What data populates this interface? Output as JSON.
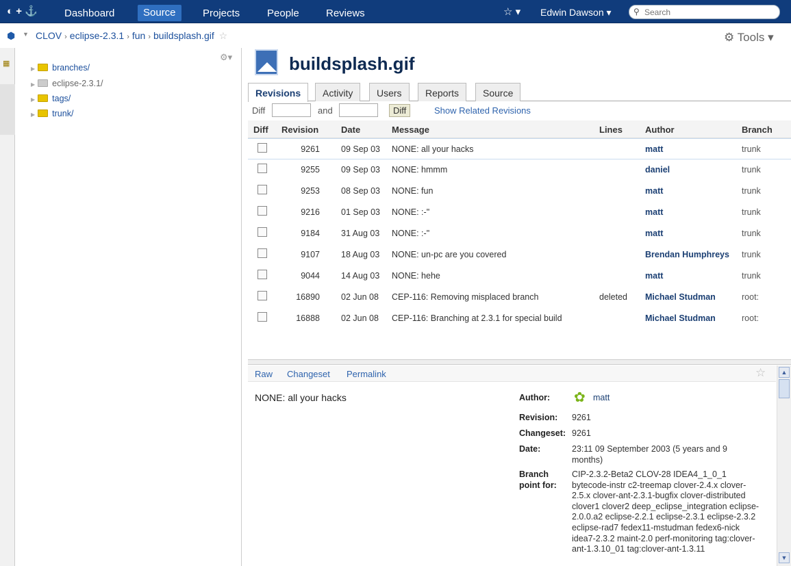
{
  "nav": {
    "logo": "◐ + ⚓",
    "items": [
      {
        "label": "Dashboard",
        "active": false
      },
      {
        "label": "Source",
        "active": true
      },
      {
        "label": "Projects",
        "active": false
      },
      {
        "label": "People",
        "active": false
      },
      {
        "label": "Reviews",
        "active": false
      }
    ],
    "star": "☆ ▾",
    "user": "Edwin Dawson ▾",
    "search_placeholder": "Search"
  },
  "breadcrumb": {
    "items": [
      "CLOV",
      "eclipse-2.3.1",
      "fun",
      "buildsplash.gif"
    ],
    "separator": "›",
    "star": "☆"
  },
  "tools_label": "⚙ Tools ▾",
  "tree": {
    "items": [
      {
        "label": "branches/",
        "muted": false
      },
      {
        "label": "eclipse-2.3.1/",
        "muted": true
      },
      {
        "label": "tags/",
        "muted": false
      },
      {
        "label": "trunk/",
        "muted": false
      }
    ]
  },
  "file": {
    "title": "buildsplash.gif"
  },
  "tabs": [
    {
      "label": "Revisions",
      "active": true
    },
    {
      "label": "Activity",
      "active": false
    },
    {
      "label": "Users",
      "active": false
    },
    {
      "label": "Reports",
      "active": false
    },
    {
      "label": "Source",
      "active": false
    }
  ],
  "diff": {
    "label_diff": "Diff",
    "label_and": "and",
    "button": "Diff",
    "show_related": "Show Related Revisions"
  },
  "table": {
    "headers": [
      "Diff",
      "Revision",
      "Date",
      "Message",
      "Lines",
      "Author",
      "Branch"
    ],
    "rows": [
      {
        "revision": "9261",
        "date": "09 Sep 03",
        "message": "NONE: all your hacks",
        "lines": "",
        "author": "matt",
        "branch": "trunk",
        "selected": true
      },
      {
        "revision": "9255",
        "date": "09 Sep 03",
        "message": "NONE: hmmm",
        "lines": "",
        "author": "daniel",
        "branch": "trunk",
        "selected": false
      },
      {
        "revision": "9253",
        "date": "08 Sep 03",
        "message": "NONE: fun",
        "lines": "",
        "author": "matt",
        "branch": "trunk",
        "selected": false
      },
      {
        "revision": "9216",
        "date": "01 Sep 03",
        "message": "NONE: :-\"",
        "lines": "",
        "author": "matt",
        "branch": "trunk",
        "selected": false
      },
      {
        "revision": "9184",
        "date": "31 Aug 03",
        "message": "NONE: :-\"",
        "lines": "",
        "author": "matt",
        "branch": "trunk",
        "selected": false
      },
      {
        "revision": "9107",
        "date": "18 Aug 03",
        "message": "NONE: un-pc are you covered",
        "lines": "",
        "author": "Brendan Humphreys",
        "branch": "trunk",
        "selected": false
      },
      {
        "revision": "9044",
        "date": "14 Aug 03",
        "message": "NONE: hehe",
        "lines": "",
        "author": "matt",
        "branch": "trunk",
        "selected": false
      },
      {
        "revision": "16890",
        "date": "02 Jun 08",
        "message": "CEP-116: Removing misplaced branch",
        "lines": "deleted",
        "author": "Michael Studman",
        "branch": "root:",
        "selected": false
      },
      {
        "revision": "16888",
        "date": "02 Jun 08",
        "message": "CEP-116: Branching at 2.3.1 for special build",
        "lines": "",
        "author": "Michael Studman",
        "branch": "root:",
        "selected": false
      }
    ]
  },
  "detail": {
    "links": [
      "Raw",
      "Changeset",
      "Permalink"
    ],
    "star": "☆",
    "message": "NONE: all your hacks",
    "labels": {
      "author": "Author:",
      "revision": "Revision:",
      "changeset": "Changeset:",
      "date": "Date:",
      "branch_point": "Branch point for:"
    },
    "author": "matt",
    "revision": "9261",
    "changeset": "9261",
    "date": "23:11 09 September 2003 (5 years and 9 months)",
    "branch_point": "CIP-2.3.2-Beta2 CLOV-28 IDEA4_1_0_1 bytecode-instr c2-treemap clover-2.4.x clover-2.5.x clover-ant-2.3.1-bugfix clover-distributed clover1 clover2 deep_eclipse_integration eclipse-2.0.0.a2 eclipse-2.2.1 eclipse-2.3.1 eclipse-2.3.2 eclipse-rad7 fedex11-mstudman fedex6-nick idea7-2.3.2 maint-2.0 perf-monitoring tag:clover-ant-1.3.10_01 tag:clover-ant-1.3.11"
  }
}
